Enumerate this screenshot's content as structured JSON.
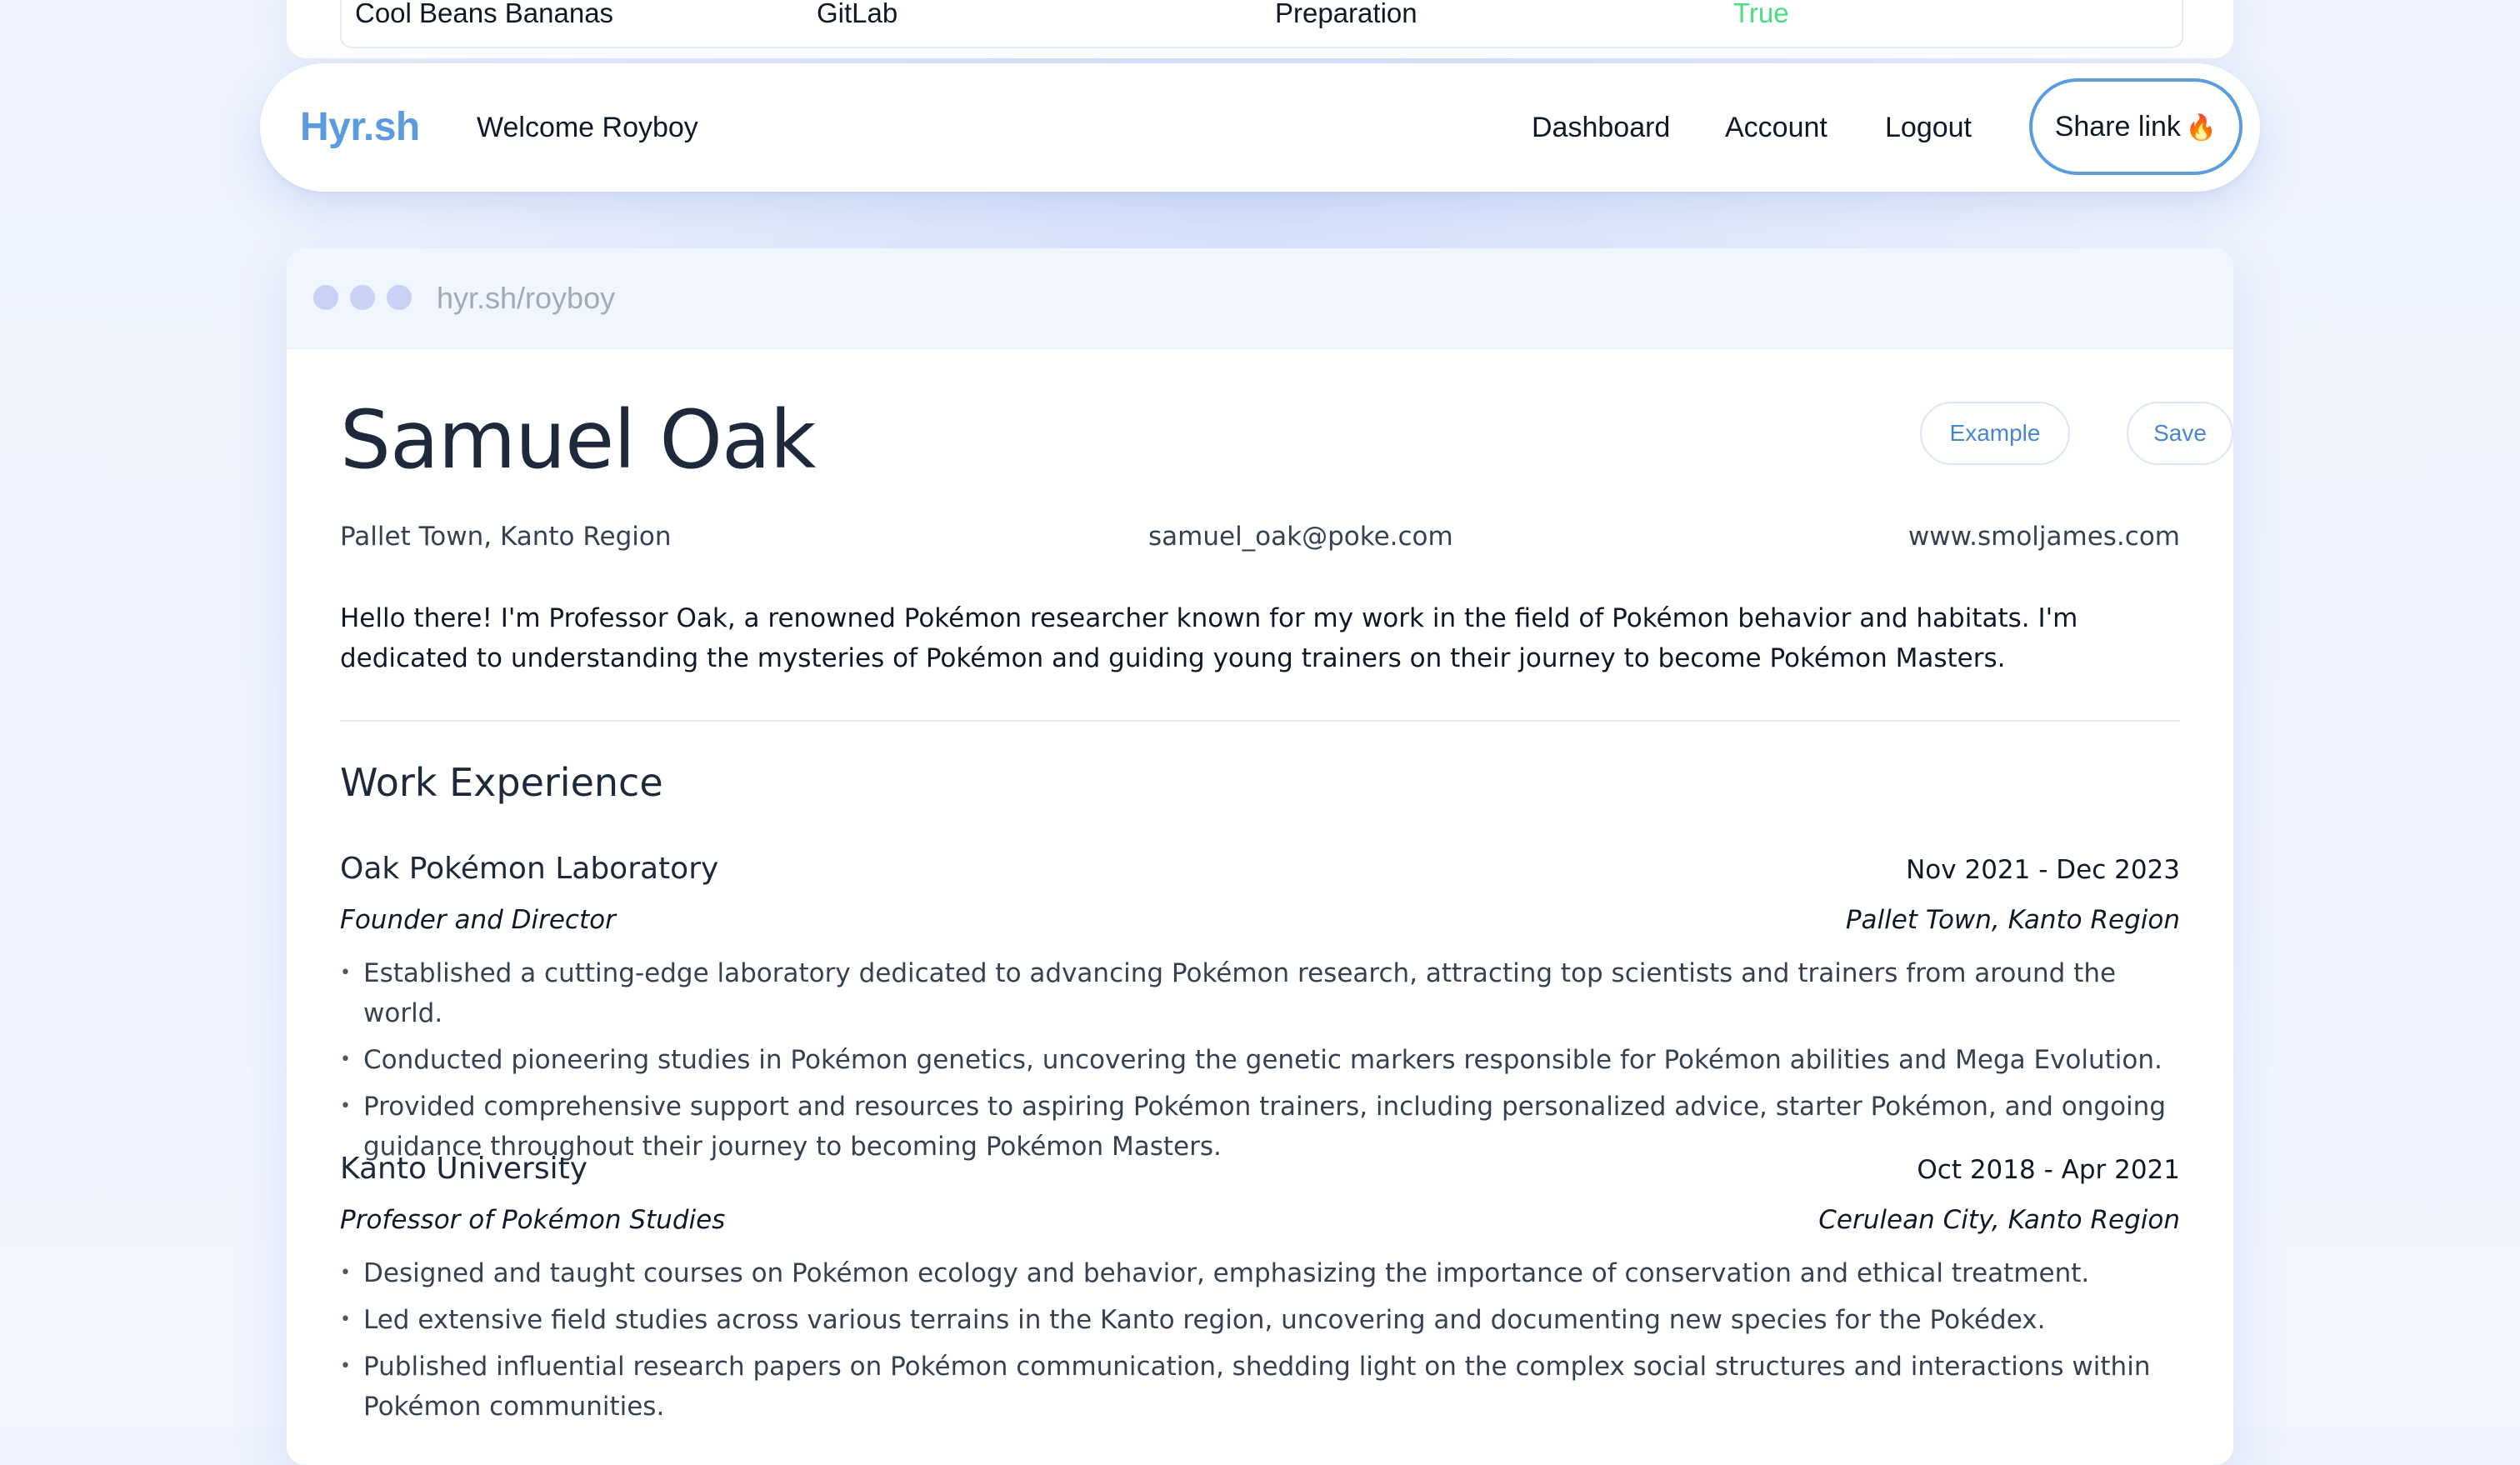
{
  "top_table_row": {
    "name": "Cool Beans Bananas",
    "source": "GitLab",
    "stage": "Preparation",
    "status": "True"
  },
  "navbar": {
    "logo": "Hyr.sh",
    "welcome": "Welcome Royboy",
    "links": [
      "Dashboard",
      "Account",
      "Logout"
    ],
    "share_label": "Share link",
    "share_icon": "flame-icon"
  },
  "browser": {
    "url": "hyr.sh/royboy"
  },
  "resume": {
    "name": "Samuel Oak",
    "buttons": {
      "example": "Example",
      "save": "Save"
    },
    "contact": {
      "location": "Pallet Town, Kanto Region",
      "email": "samuel_oak@poke.com",
      "website": "www.smoljames.com"
    },
    "summary": "Hello there! I'm Professor Oak, a renowned Pokémon researcher known for my work in the field of Pokémon behavior and habitats. I'm dedicated to understanding the mysteries of Pokémon and guiding young trainers on their journey to become Pokémon Masters.",
    "section_title": "Work Experience",
    "jobs": [
      {
        "company": "Oak Pokémon Laboratory",
        "dates": "Nov 2021 - Dec 2023",
        "title": "Founder and Director",
        "location": "Pallet Town, Kanto Region",
        "bullets": [
          "Established a cutting-edge laboratory dedicated to advancing Pokémon research, attracting top scientists and trainers from around the world.",
          "Conducted pioneering studies in Pokémon genetics, uncovering the genetic markers responsible for Pokémon abilities and Mega Evolution.",
          "Provided comprehensive support and resources to aspiring Pokémon trainers, including personalized advice, starter Pokémon, and ongoing guidance throughout their journey to becoming Pokémon Masters."
        ]
      },
      {
        "company": "Kanto University",
        "dates": "Oct 2018 - Apr 2021",
        "title": "Professor of Pokémon Studies",
        "location": "Cerulean City, Kanto Region",
        "bullets": [
          "Designed and taught courses on Pokémon ecology and behavior, emphasizing the importance of conservation and ethical treatment.",
          "Led extensive field studies across various terrains in the Kanto region, uncovering and documenting new species for the Pokédex.",
          "Published influential research papers on Pokémon communication, shedding light on the complex social structures and interactions within Pokémon communities."
        ]
      }
    ]
  }
}
